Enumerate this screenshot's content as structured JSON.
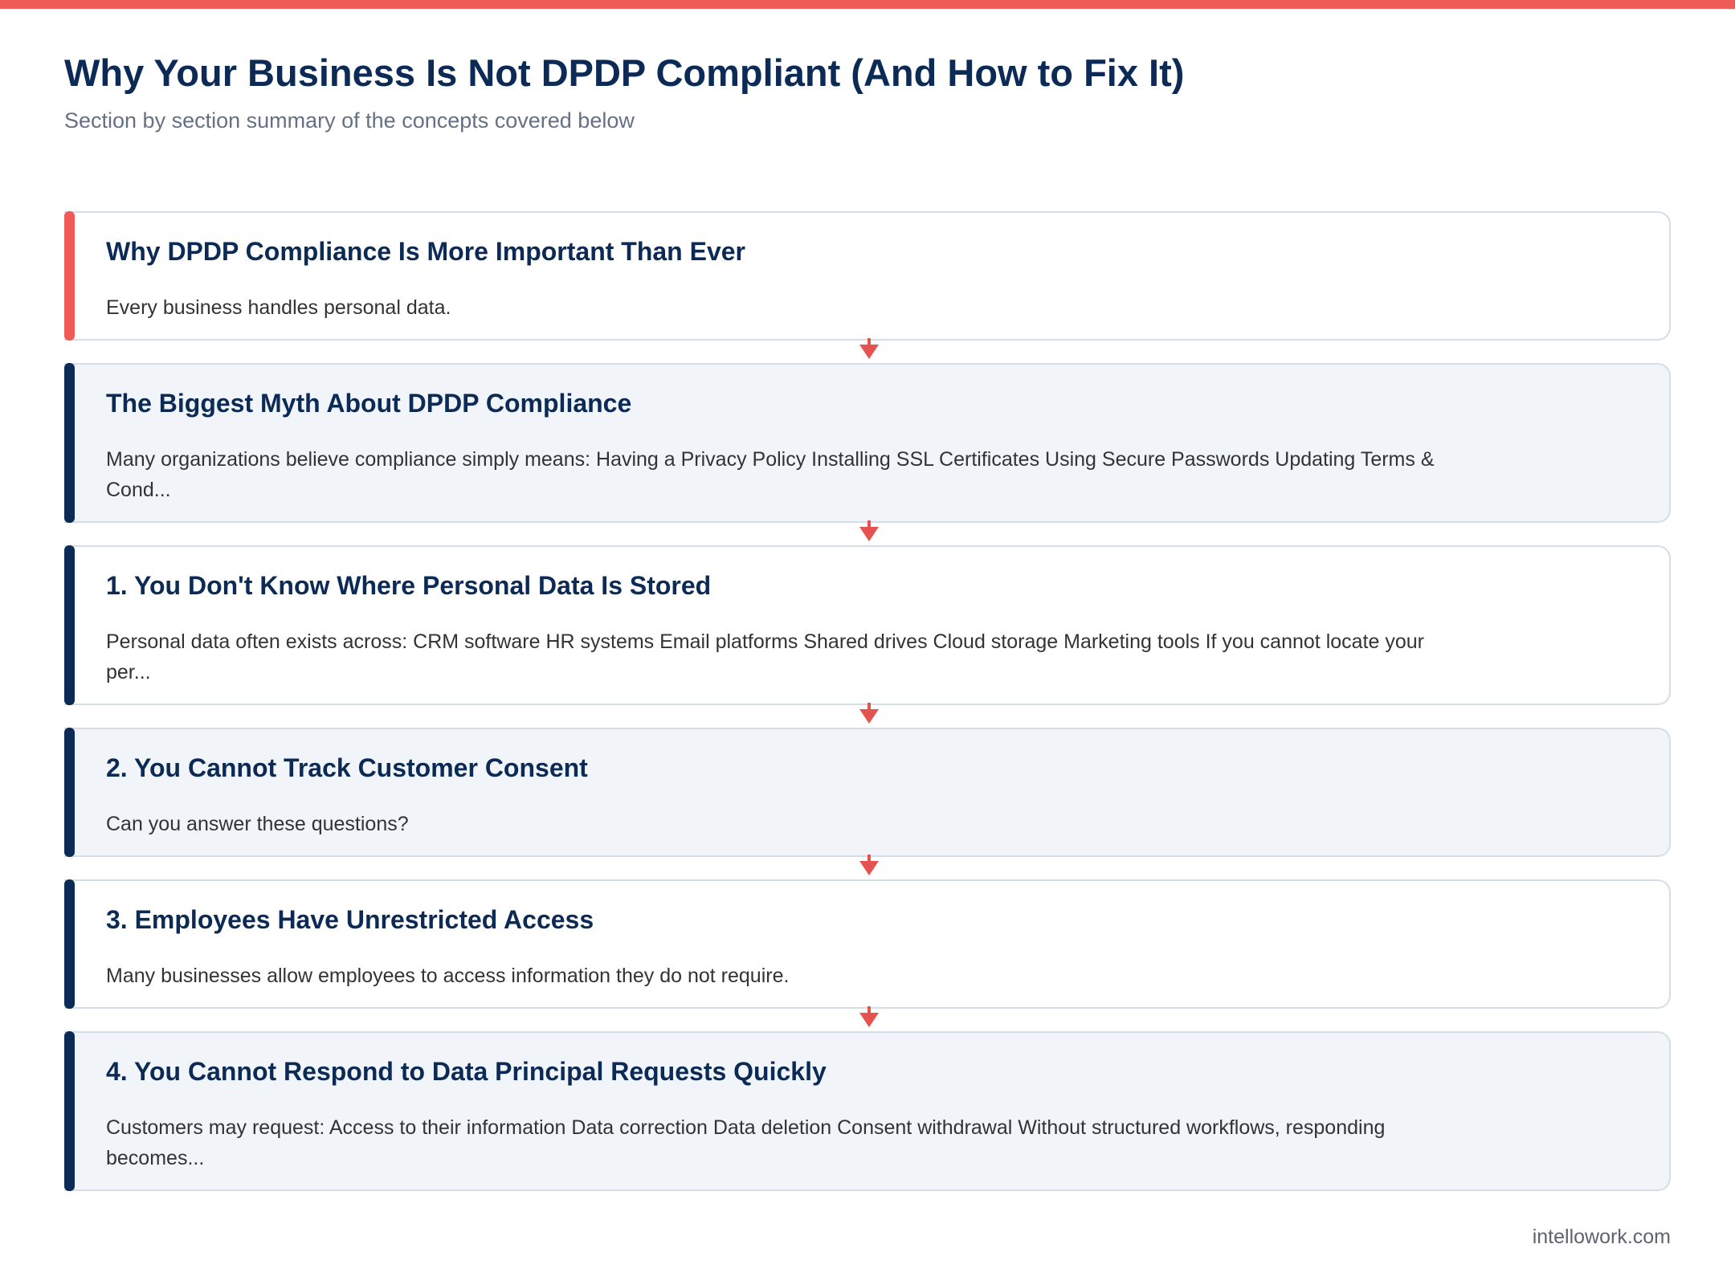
{
  "page": {
    "title": "Why Your Business Is Not DPDP Compliant (And How to Fix It)",
    "subtitle": "Section by section summary of the concepts covered below",
    "accent_color": "#ef5b57",
    "navy_color": "#0c2a56"
  },
  "sections": [
    {
      "title": "Why DPDP Compliance Is More Important Than Ever",
      "text": "Every business handles personal data."
    },
    {
      "title": "The Biggest Myth About DPDP Compliance",
      "text": "Many organizations believe compliance simply means: Having a Privacy Policy Installing SSL Certificates Using Secure Passwords Updating Terms & Cond..."
    },
    {
      "title": "1. You Don't Know Where Personal Data Is Stored",
      "text": "Personal data often exists across: CRM software HR systems Email platforms Shared drives Cloud storage Marketing tools If you cannot locate your per..."
    },
    {
      "title": "2. You Cannot Track Customer Consent",
      "text": "Can you answer these questions?"
    },
    {
      "title": "3. Employees Have Unrestricted Access",
      "text": "Many businesses allow employees to access information they do not require."
    },
    {
      "title": "4. You Cannot Respond to Data Principal Requests Quickly",
      "text": "Customers may request: Access to their information Data correction Data deletion Consent withdrawal Without structured workflows, responding becomes..."
    }
  ],
  "footer": {
    "domain": "intellowork.com"
  }
}
